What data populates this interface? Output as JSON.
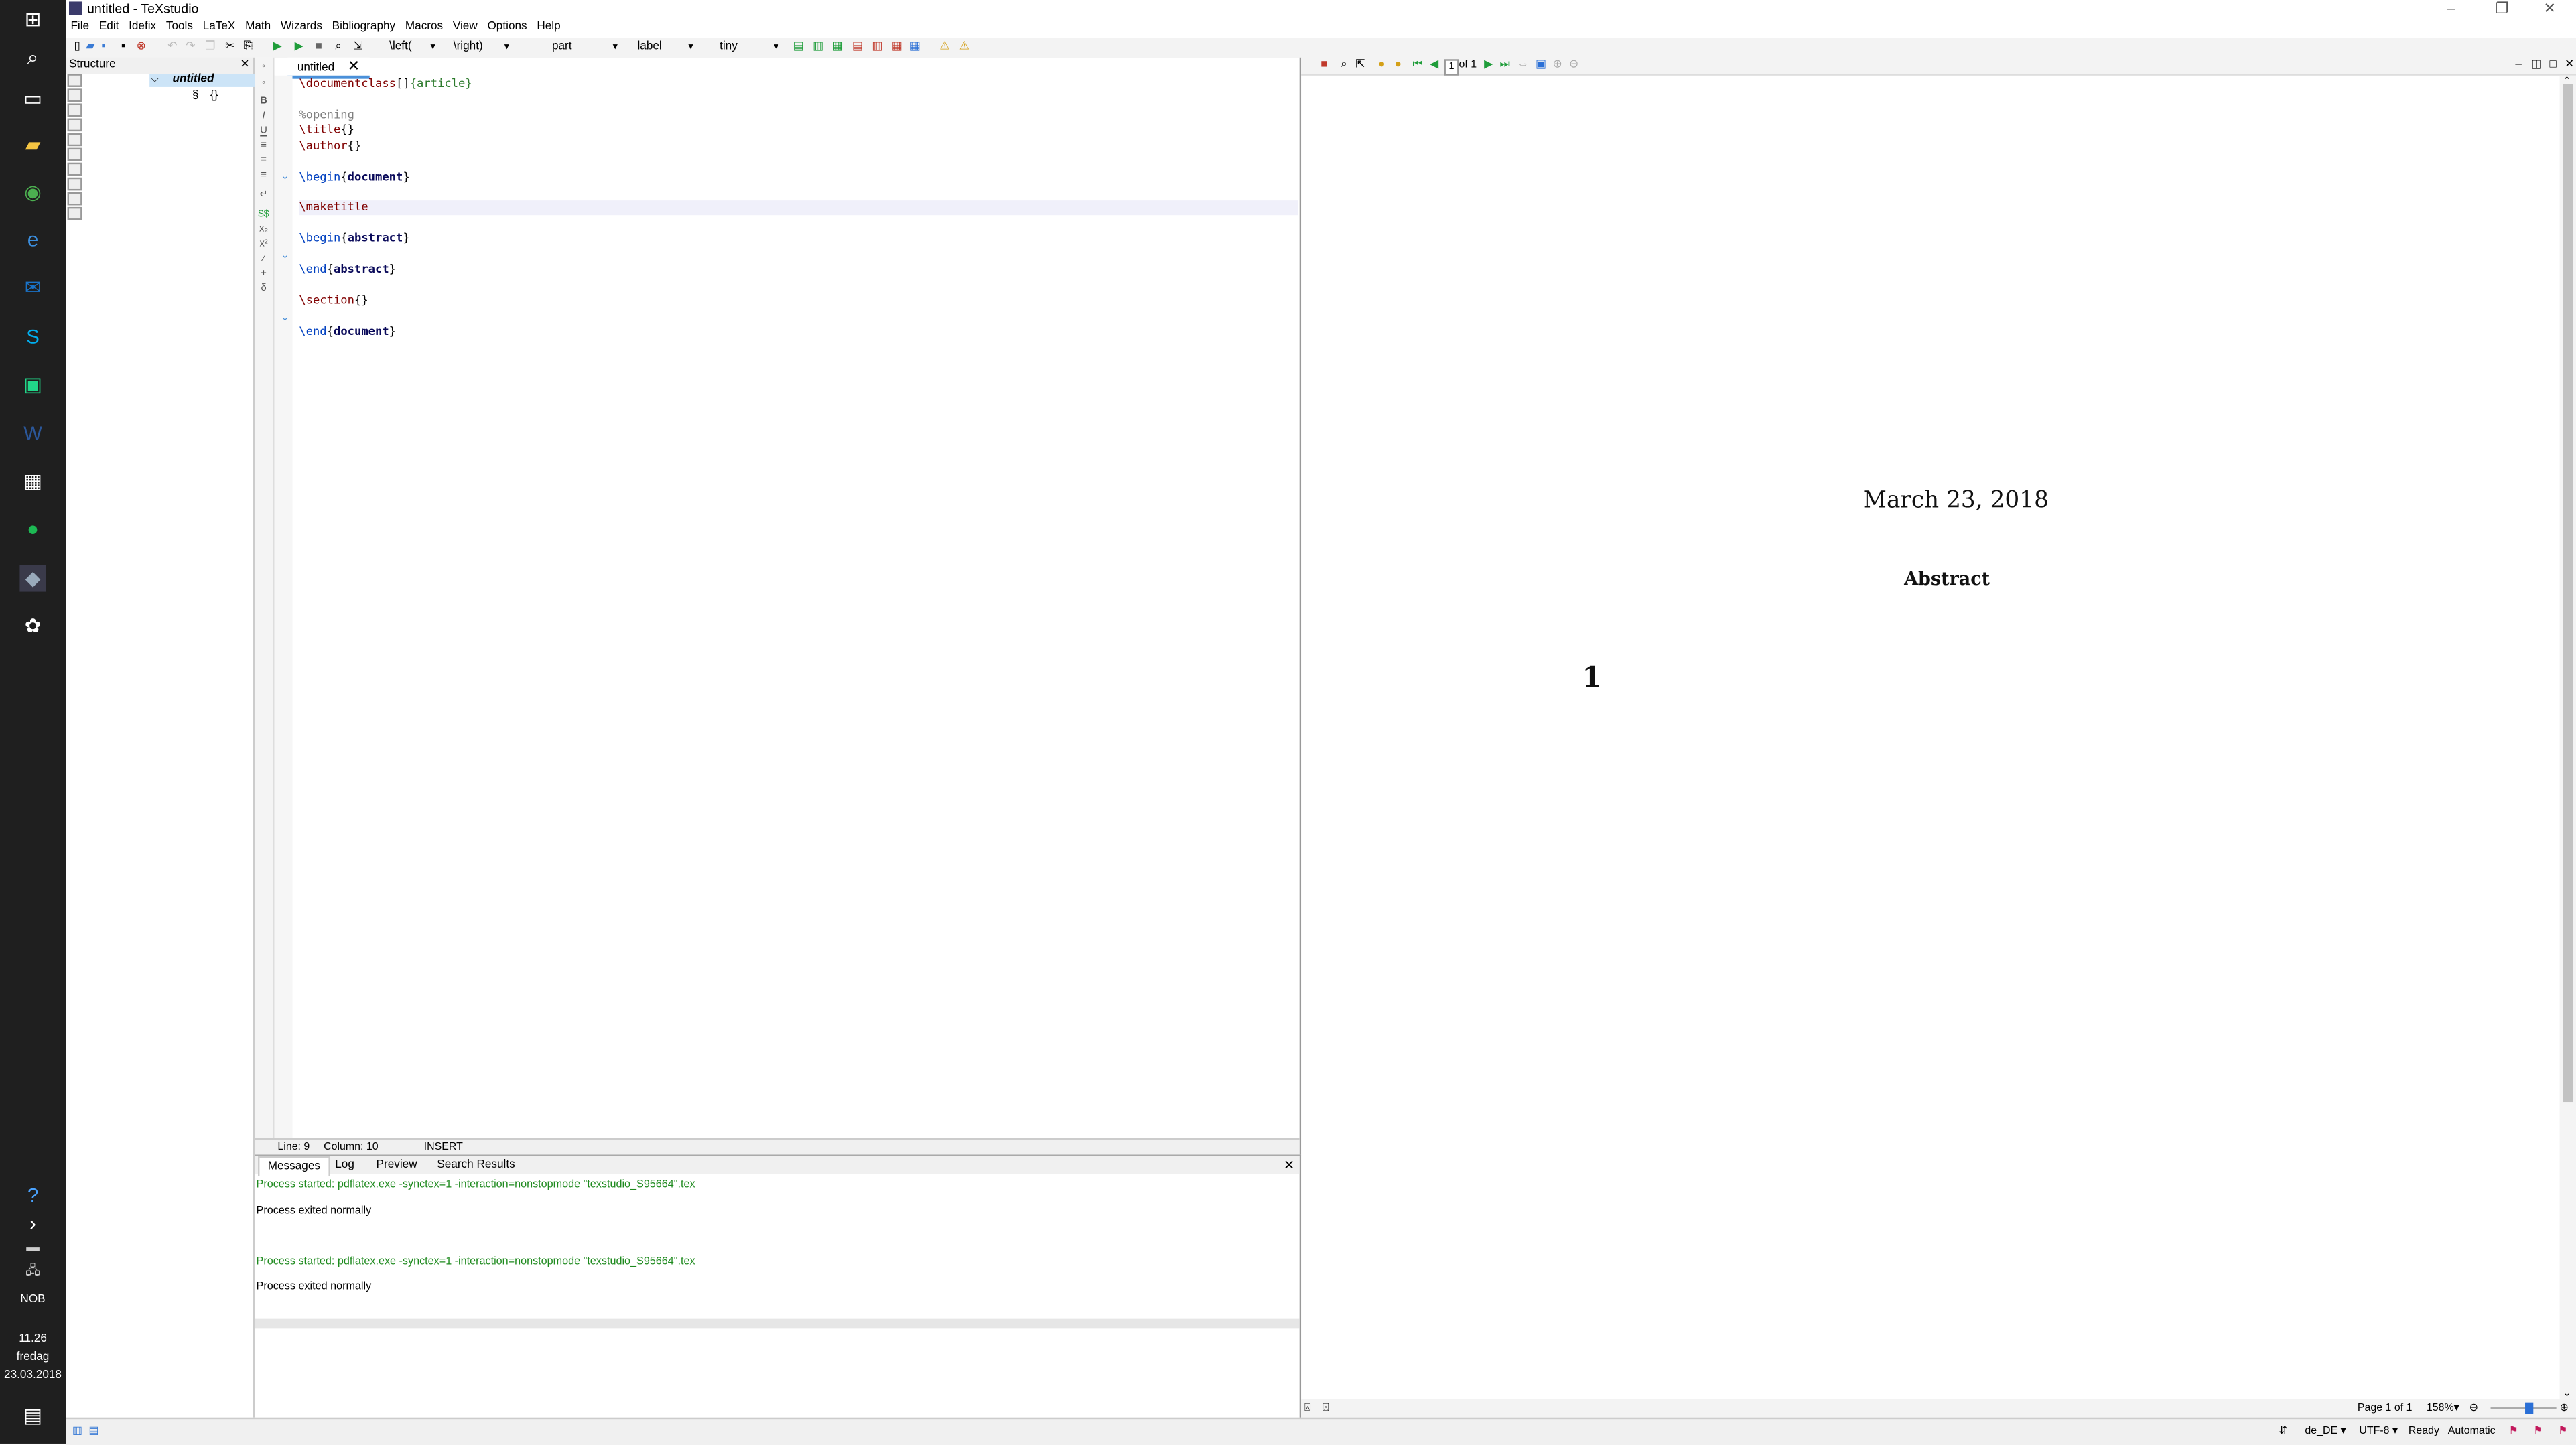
{
  "window": {
    "title": "untitled - TeXstudio"
  },
  "taskbar": {
    "time": "11.26",
    "day": "fredag",
    "date": "23.03.2018",
    "language": "NOB"
  },
  "menu": {
    "items": [
      "File",
      "Edit",
      "Idefix",
      "Tools",
      "LaTeX",
      "Math",
      "Wizards",
      "Bibliography",
      "Macros",
      "View",
      "Options",
      "Help"
    ]
  },
  "toolbar": {
    "left_combo": "\\left(",
    "right_combo": "\\right)",
    "section_combo": "part",
    "label_combo": "label",
    "size_combo": "tiny"
  },
  "structure": {
    "header": "Structure",
    "root": "untitled",
    "child": "{}"
  },
  "editor": {
    "tab_label": "untitled",
    "status": {
      "line": "Line: 9",
      "column": "Column: 10",
      "mode": "INSERT"
    }
  },
  "messages": {
    "tabs": [
      "Messages",
      "Log",
      "Preview",
      "Search Results"
    ],
    "lines": [
      "Process started: pdflatex.exe -synctex=1 -interaction=nonstopmode \"texstudio_S95664\".tex",
      "Process exited normally",
      "Process started: pdflatex.exe -synctex=1 -interaction=nonstopmode \"texstudio_S95664\".tex",
      "Process exited normally"
    ]
  },
  "pdf": {
    "page_input": "1",
    "page_of": "of 1",
    "date": "March 23, 2018",
    "abstract_heading": "Abstract",
    "section_number": "1",
    "page_status": "Page 1 of 1",
    "zoom": "158%"
  },
  "statusbar": {
    "language": "de_DE",
    "encoding": "UTF-8",
    "state": "Ready",
    "mode": "Automatic"
  }
}
